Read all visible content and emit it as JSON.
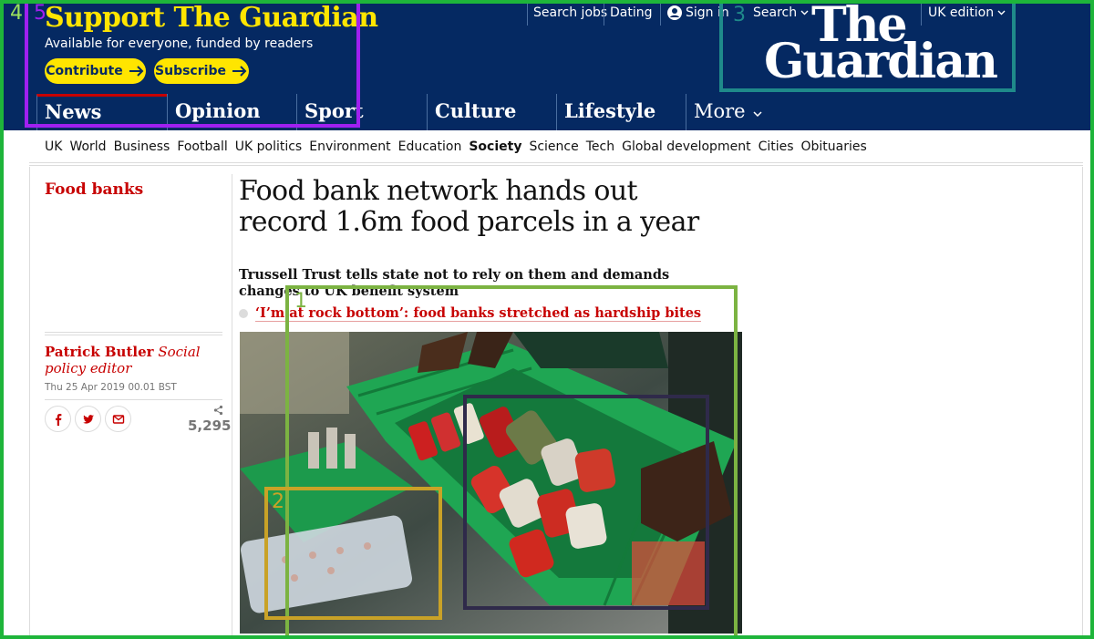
{
  "support": {
    "title": "Support The Guardian",
    "subtitle": "Available for everyone, funded by readers",
    "contribute_label": "Contribute",
    "subscribe_label": "Subscribe"
  },
  "toplinks": {
    "search_jobs": "Search jobs",
    "dating": "Dating",
    "sign_in": "Sign in",
    "search": "Search",
    "edition": "UK edition"
  },
  "logo": {
    "line1": "The",
    "line2": "Guardian"
  },
  "pillars": [
    "News",
    "Opinion",
    "Sport",
    "Culture",
    "Lifestyle",
    "More"
  ],
  "subnav": [
    "UK",
    "World",
    "Business",
    "Football",
    "UK politics",
    "Environment",
    "Education",
    "Society",
    "Science",
    "Tech",
    "Global development",
    "Cities",
    "Obituaries"
  ],
  "subnav_current": "Society",
  "article": {
    "kicker": "Food banks",
    "headline": "Food bank network hands out record 1.6m food parcels in a year",
    "standfirst": "Trussell Trust tells state not to rely on them and demands changes to UK benefit system",
    "related_link": "‘I’m at rock bottom’: food banks stretched as hardship bites",
    "byline_name": "Patrick Butler",
    "byline_role": "Social policy editor",
    "date": "Thu 25 Apr 2019 00.01 BST",
    "share_count": "5,295"
  },
  "annotations": [
    "1",
    "2",
    "3",
    "4",
    "5"
  ],
  "colors": {
    "brand_blue": "#052962",
    "support_yellow": "#ffe500",
    "news_red": "#c70000",
    "frame_green": "#1eb53a"
  },
  "icons": [
    "arrow-right-icon",
    "user-icon",
    "chevron-down-icon",
    "facebook-icon",
    "twitter-icon",
    "email-icon",
    "share-icon"
  ]
}
